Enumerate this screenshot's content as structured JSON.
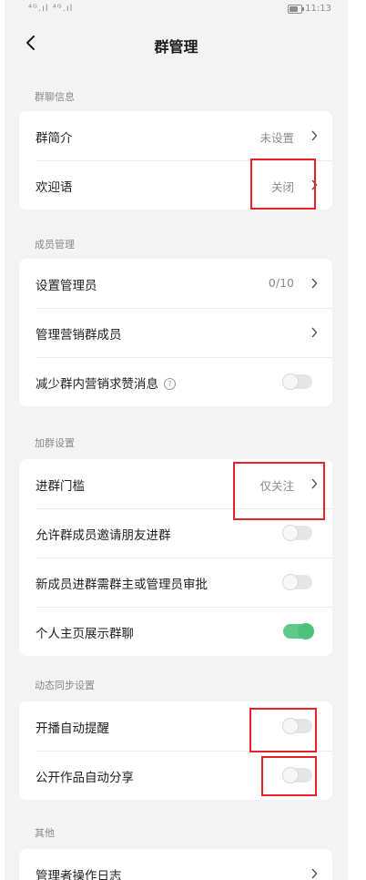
{
  "status": {
    "signal": "⁴ᴳ.ıl ⁴ᴳ.ıl",
    "time": "11:13"
  },
  "nav": {
    "title": "群管理"
  },
  "sections": {
    "info": {
      "title": "群聊信息",
      "rows": [
        {
          "label": "群简介",
          "value": "未设置"
        },
        {
          "label": "欢迎语",
          "value": "关闭"
        }
      ]
    },
    "members": {
      "title": "成员管理",
      "rows": [
        {
          "label": "设置管理员",
          "value": "0/10"
        },
        {
          "label": "管理营销群成员"
        },
        {
          "label": "减少群内营销求赞消息",
          "help": "?",
          "toggle": false
        }
      ]
    },
    "join": {
      "title": "加群设置",
      "rows": [
        {
          "label": "进群门槛",
          "value": "仅关注"
        },
        {
          "label": "允许群成员邀请朋友进群",
          "toggle": false
        },
        {
          "label": "新成员进群需群主或管理员审批",
          "toggle": false
        },
        {
          "label": "个人主页展示群聊",
          "toggle": true
        }
      ]
    },
    "sync": {
      "title": "动态同步设置",
      "rows": [
        {
          "label": "开播自动提醒",
          "toggle": false
        },
        {
          "label": "公开作品自动分享",
          "toggle": false
        }
      ]
    },
    "other": {
      "title": "其他",
      "rows": [
        {
          "label": "管理者操作日志"
        }
      ]
    }
  },
  "colors": {
    "highlight": "#e8202a",
    "toggle_on": "#4fbf7c",
    "background": "#f3f3f4"
  }
}
